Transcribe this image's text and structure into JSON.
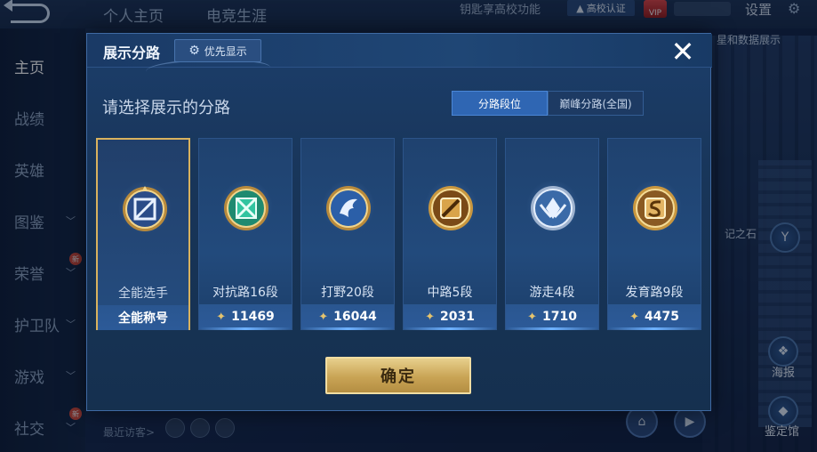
{
  "top": {
    "tabs": [
      "个人主页",
      "电竞生涯"
    ],
    "notice": "钥匙享高校功能",
    "campus_badge": "高校认证",
    "vip": "VIP",
    "settings": "设置",
    "right_hint": "星和数据展示",
    "right_hint2": "记之石"
  },
  "sidebar": {
    "items": [
      {
        "label": "主页",
        "active": true
      },
      {
        "label": "战绩"
      },
      {
        "label": "英雄"
      },
      {
        "label": "图鉴"
      },
      {
        "label": "荣誉"
      },
      {
        "label": "护卫队"
      },
      {
        "label": "游戏"
      },
      {
        "label": "社交"
      }
    ],
    "new_badge": "新"
  },
  "bottom": {
    "visitors_label": "最近访客>",
    "right_labels": [
      "海报",
      "鉴定馆"
    ]
  },
  "modal": {
    "title": "展示分路",
    "priority_label": "优先显示",
    "close_label": "✕",
    "subtitle": "请选择展示的分路",
    "segments": [
      {
        "label": "分路段位",
        "active": true
      },
      {
        "label": "巅峰分路(全国)",
        "active": false
      }
    ],
    "cards": [
      {
        "role": "全能选手",
        "stat": "全能称号",
        "selected": true,
        "emblem": "allround-emblem-icon"
      },
      {
        "role": "对抗路16段",
        "stat": "11469",
        "selected": false,
        "emblem": "clash-lane-emblem-icon"
      },
      {
        "role": "打野20段",
        "stat": "16044",
        "selected": false,
        "emblem": "jungle-emblem-icon"
      },
      {
        "role": "中路5段",
        "stat": "2031",
        "selected": false,
        "emblem": "mid-lane-emblem-icon"
      },
      {
        "role": "游走4段",
        "stat": "1710",
        "selected": false,
        "emblem": "roam-emblem-icon"
      },
      {
        "role": "发育路9段",
        "stat": "4475",
        "selected": false,
        "emblem": "farm-lane-emblem-icon"
      }
    ],
    "confirm_label": "确定"
  }
}
